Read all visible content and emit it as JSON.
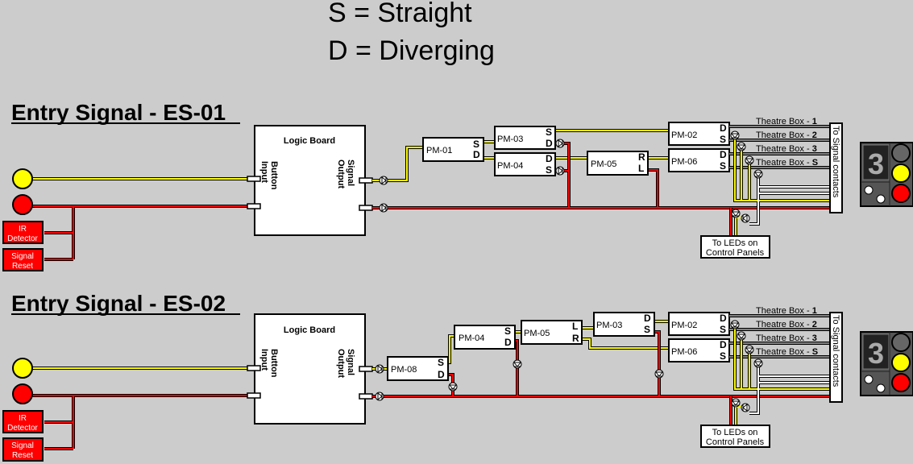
{
  "legend": {
    "straight": "S = Straight",
    "diverging": "D = Diverging"
  },
  "colors": {
    "background": "#cccccc",
    "yellow_wire": "#ffff00",
    "red_wire": "#ff0000",
    "gray_wire": "#808080",
    "white_wire": "#ffffff"
  },
  "sections": [
    {
      "title": "Entry Signal - ES-01",
      "logic_board": {
        "title": "Logic Board",
        "input_label": "Button Input",
        "output_label": "Signal Output"
      },
      "ir_detector": "IR Detector",
      "signal_reset": "Signal Reset",
      "point_motors": [
        {
          "name": "PM-01",
          "pins": [
            "S",
            "D"
          ]
        },
        {
          "name": "PM-03",
          "pins": [
            "S",
            "D"
          ]
        },
        {
          "name": "PM-04",
          "pins": [
            "D",
            "S"
          ]
        },
        {
          "name": "PM-05",
          "pins": [
            "R",
            "L"
          ]
        },
        {
          "name": "PM-02",
          "pins": [
            "D",
            "S"
          ]
        },
        {
          "name": "PM-06",
          "pins": [
            "D",
            "S"
          ]
        }
      ],
      "theatre_boxes": [
        {
          "prefix": "Theatre Box - ",
          "suffix": "1"
        },
        {
          "prefix": "Theatre Box - ",
          "suffix": "2"
        },
        {
          "prefix": "Theatre Box - ",
          "suffix": "3"
        },
        {
          "prefix": "Theatre Box - ",
          "suffix": "S"
        }
      ],
      "signal_contacts": "To Signal contacts",
      "leds_label_1": "To LEDs on",
      "leds_label_2": "Control Panels",
      "theatre_display": "3"
    },
    {
      "title": "Entry Signal - ES-02",
      "logic_board": {
        "title": "Logic Board",
        "input_label": "Button Input",
        "output_label": "Signal Output"
      },
      "ir_detector": "IR Detector",
      "signal_reset": "Signal Reset",
      "point_motors": [
        {
          "name": "PM-08",
          "pins": [
            "S",
            "D"
          ]
        },
        {
          "name": "PM-04",
          "pins": [
            "S",
            "D"
          ]
        },
        {
          "name": "PM-05",
          "pins": [
            "L",
            "R"
          ]
        },
        {
          "name": "PM-03",
          "pins": [
            "D",
            "S"
          ]
        },
        {
          "name": "PM-02",
          "pins": [
            "D",
            "S"
          ]
        },
        {
          "name": "PM-06",
          "pins": [
            "D",
            "S"
          ]
        }
      ],
      "theatre_boxes": [
        {
          "prefix": "Theatre Box - ",
          "suffix": "1"
        },
        {
          "prefix": "Theatre Box - ",
          "suffix": "2"
        },
        {
          "prefix": "Theatre Box - ",
          "suffix": "3"
        },
        {
          "prefix": "Theatre Box - ",
          "suffix": "S"
        }
      ],
      "signal_contacts": "To Signal contacts",
      "leds_label_1": "To LEDs on",
      "leds_label_2": "Control Panels",
      "theatre_display": "3"
    }
  ]
}
